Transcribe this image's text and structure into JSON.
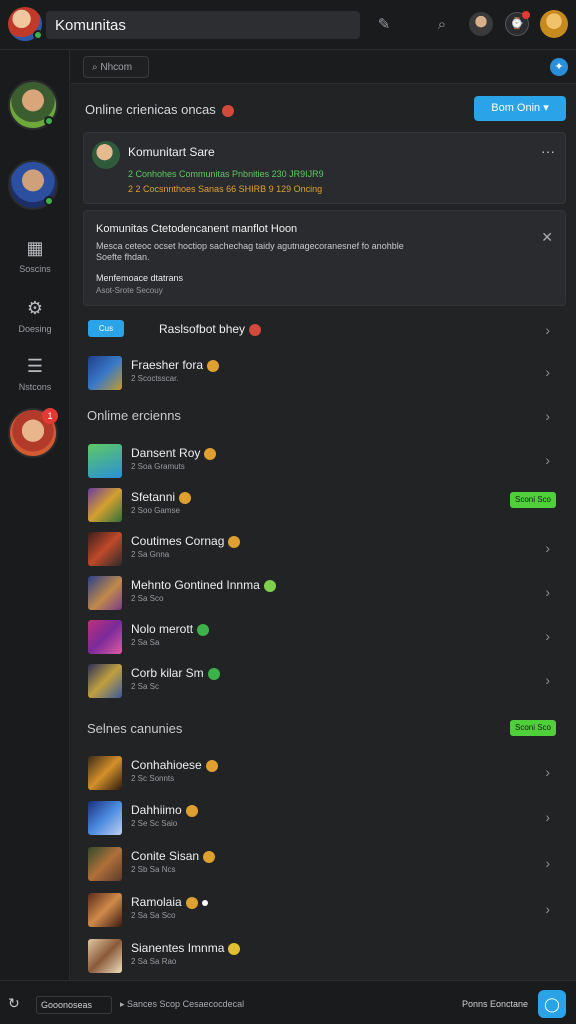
{
  "app": {
    "title": "Komunitas"
  },
  "topbar": {
    "icons": [
      "pen-icon",
      "search-icon",
      "profile-icon",
      "notifications-icon",
      "user-avatar"
    ]
  },
  "search": {
    "placeholder": "Nhcom"
  },
  "header": {
    "title": "Online crienicas oncas",
    "button_label": "Bom Onin"
  },
  "card_post": {
    "title": "Komunitart Sare",
    "meta_line1": "2 Conhohes  Communitas  Pnbnities  230  JR9IJR9",
    "meta_line2": "2 2 Cocsnnthoes Sanas 66 SHIRB 9 129 Oncing"
  },
  "card_notice": {
    "title": "Komunitas Ctetodencanent manflot Hoon",
    "body_line1": "Mesca ceteoc ocset hoctiop sachechag taidy agutnagecoranesnef fo anohble",
    "body_line2": "Soefte fhdan.",
    "footer_line1": "Menfemoace dtatrans",
    "footer_line2": "Asot-Srote Secouy"
  },
  "featured": [
    {
      "pill": "Cus",
      "title": "Raslsofbot bhey",
      "sub": ""
    },
    {
      "title": "Fraesher fora",
      "sub": "2 Scoctsscar."
    }
  ],
  "section_online": {
    "title": "Onlime ercienns"
  },
  "online_rows": [
    {
      "title": "Dansent Roy",
      "sub": "2 Soa Gramuts"
    },
    {
      "title": "Sfetanni",
      "sub": "2 Soo Gamse",
      "tag": "Sconi Sco"
    },
    {
      "title": "Coutimes Cornag",
      "sub": "2 Sa Gnna"
    },
    {
      "title": "Mehnto Gontined Innma",
      "sub": "2 Sa Sco"
    },
    {
      "title": "Nolo merott",
      "sub": "2 Sa Sa"
    },
    {
      "title": "Corb kilar Sm",
      "sub": "2 Sa Sc"
    }
  ],
  "section_senior": {
    "title": "Selnes canunies",
    "tag": "Sconi Sco"
  },
  "senior_rows": [
    {
      "title": "Conhahioese",
      "sub": "2 Sc Sonnts"
    },
    {
      "title": "Dahhiimo",
      "sub": "2 Se Sc Saio"
    },
    {
      "title": "Conite Sisan",
      "sub": "2 Sb Sa Ncs"
    },
    {
      "title": "Ramolaia",
      "sub": "2 Sa Sa Sco"
    },
    {
      "title": "Sianentes Imnma",
      "sub": "2 Sa Sa Rao"
    }
  ],
  "rail": {
    "items": [
      {
        "label": "Soscins",
        "icon": "columns-icon"
      },
      {
        "label": "Doesing",
        "icon": "gear-icon"
      },
      {
        "label": "Nstcons",
        "icon": "list-icon"
      }
    ],
    "badge": "1"
  },
  "bottom": {
    "select_label": "Gooonoseas",
    "hint": "Sances Scop Cesaecocdecal",
    "right_label": "Ponns Eonctane"
  },
  "colors": {
    "accent": "#2aa3e8",
    "green": "#4fcf3a",
    "bg": "#222325"
  }
}
